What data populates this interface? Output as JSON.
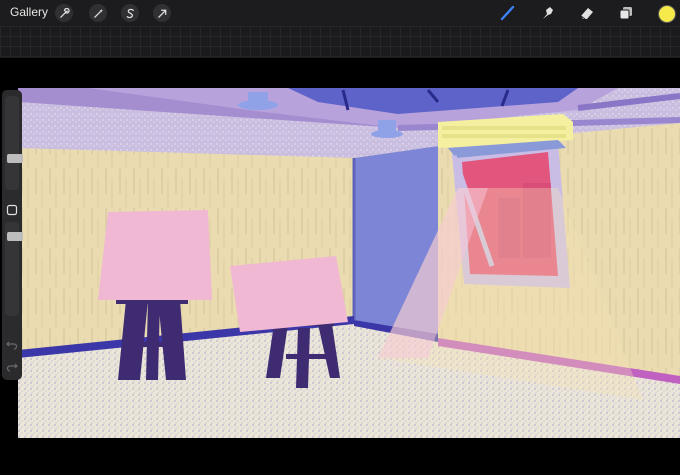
{
  "toolbar": {
    "gallery_label": "Gallery",
    "left_tools": [
      {
        "name": "actions",
        "icon": "wrench-icon"
      },
      {
        "name": "adjustments",
        "icon": "magic-wand-icon"
      },
      {
        "name": "selection",
        "icon": "selection-s-icon"
      },
      {
        "name": "transform",
        "icon": "cursor-arrow-icon"
      }
    ],
    "right_tools": [
      {
        "name": "brush",
        "icon": "brush-icon",
        "active": true
      },
      {
        "name": "smudge",
        "icon": "smudge-finger-icon"
      },
      {
        "name": "eraser",
        "icon": "eraser-icon"
      },
      {
        "name": "layers",
        "icon": "layers-icon"
      }
    ],
    "active_color": "#f6e94a",
    "accent_color": "#3b82f6"
  },
  "sidebar": {
    "brush_size_level": 0.35,
    "opacity_level": 0.75,
    "buttons": [
      "modify-square-icon",
      "undo-icon",
      "redo-icon"
    ]
  },
  "artwork": {
    "palette": {
      "wall": "#eadbb0",
      "ceiling": "#a58ed0",
      "floor": "#ebe6d4",
      "blue_wall": "#7d86d6",
      "canvas_pink": "#f0b8d2",
      "easel": "#3e2b72",
      "window": "#e2557c",
      "light": "#f6e2b4"
    }
  }
}
